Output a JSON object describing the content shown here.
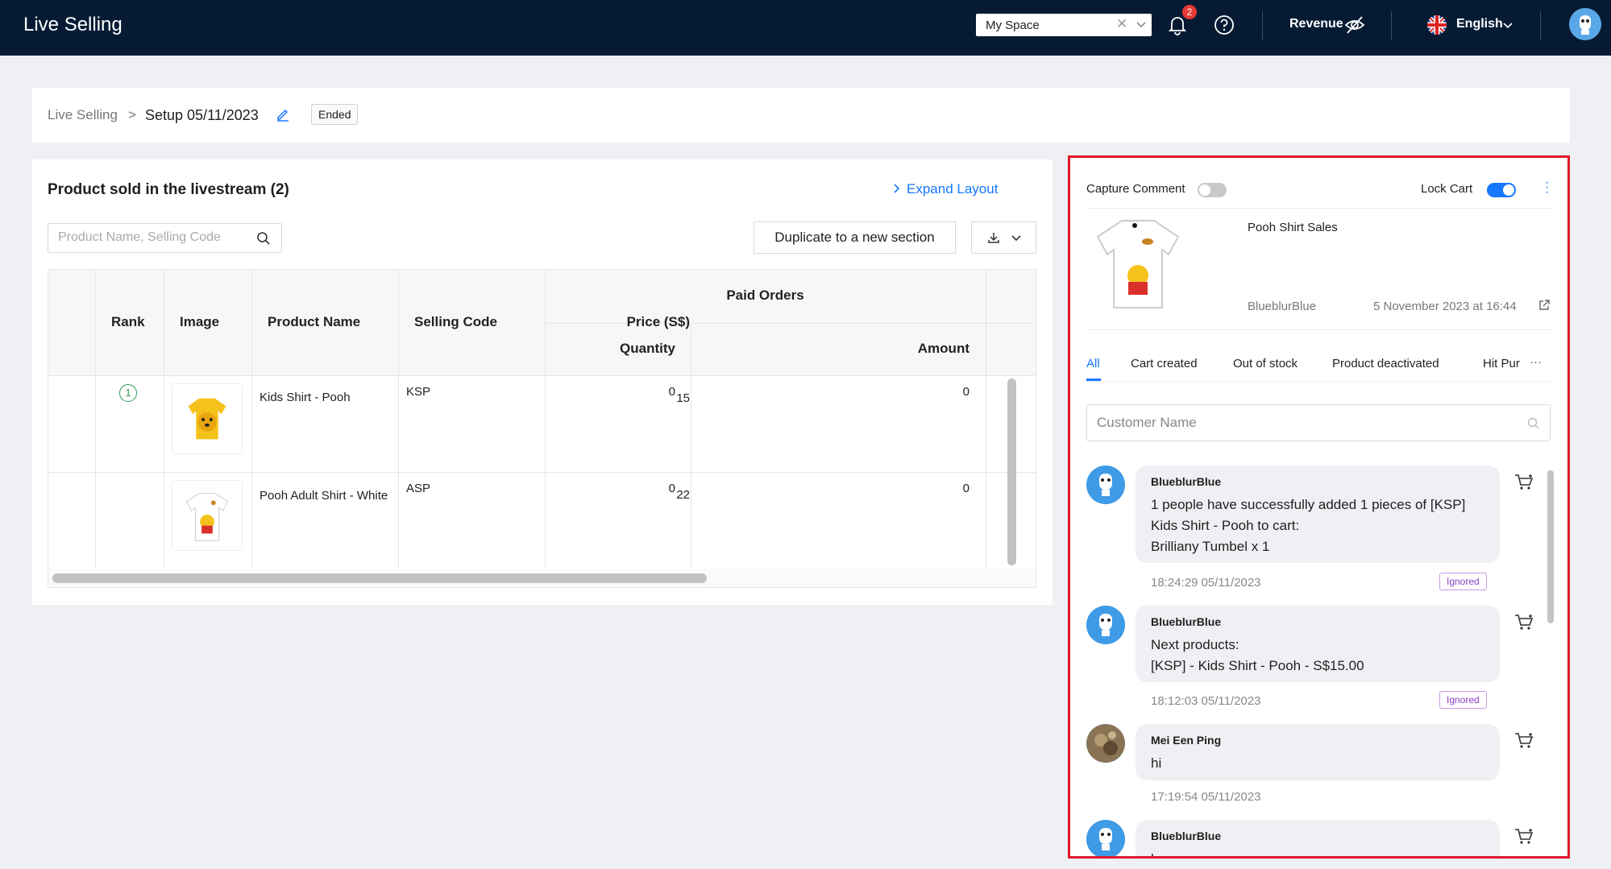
{
  "topbar": {
    "app_title": "Live Selling",
    "space_select_value": "My Space",
    "notification_count": "2",
    "revenue_label": "Revenue",
    "language_label": "English"
  },
  "breadcrumb": {
    "root": "Live Selling",
    "separator": ">",
    "current": "Setup 05/11/2023",
    "status": "Ended"
  },
  "products_panel": {
    "title": "Product sold in the livestream (2)",
    "expand_label": "Expand Layout",
    "search_placeholder": "Product Name, Selling Code",
    "duplicate_label": "Duplicate to a new section",
    "columns": {
      "rank": "Rank",
      "image": "Image",
      "product_name": "Product Name",
      "selling_code": "Selling Code",
      "price": "Price (S$)",
      "paid_orders": "Paid Orders",
      "quantity": "Quantity",
      "amount": "Amount"
    },
    "rows": [
      {
        "rank": "1",
        "name": "Kids Shirt - Pooh",
        "code": "KSP",
        "price": "15",
        "quantity": "0",
        "amount": "0"
      },
      {
        "rank": "",
        "name": "Pooh Adult Shirt - White",
        "code": "ASP",
        "price": "22",
        "quantity": "0",
        "amount": "0"
      }
    ]
  },
  "comments_panel": {
    "capture_comment_label": "Capture Comment",
    "capture_comment_on": false,
    "lock_cart_label": "Lock Cart",
    "lock_cart_on": true,
    "stream_title": "Pooh Shirt Sales",
    "stream_author": "BlueblurBlue",
    "stream_date": "5 November 2023 at 16:44",
    "tabs": [
      "All",
      "Cart created",
      "Out of stock",
      "Product deactivated",
      "Hit Pur"
    ],
    "more_tabs": "···",
    "customer_search_placeholder": "Customer Name",
    "messages": [
      {
        "name": "BlueblurBlue",
        "text": "1 people have successfully added 1 pieces of [KSP] Kids Shirt - Pooh to cart:\nBrilliany Tumbel x 1",
        "time": "18:24:29 05/11/2023",
        "status": "Ignored"
      },
      {
        "name": "BlueblurBlue",
        "text": "Next products:\n[KSP] - Kids Shirt - Pooh - S$15.00",
        "time": "18:12:03 05/11/2023",
        "status": "Ignored"
      },
      {
        "name": "Mei Een Ping",
        "text": "hi",
        "time": "17:19:54 05/11/2023",
        "status": ""
      },
      {
        "name": "BlueblurBlue",
        "text": "hey",
        "time": "",
        "status": ""
      }
    ]
  },
  "colors": {
    "topbar_bg": "#061b33",
    "accent": "#1677ff",
    "highlight_border": "#e0192c",
    "ignored_tag": "#8a3fc4",
    "rank_green": "#2e9b55"
  }
}
